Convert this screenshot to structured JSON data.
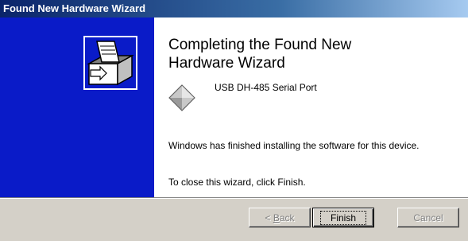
{
  "window": {
    "title": "Found New Hardware Wizard"
  },
  "content": {
    "heading_line1": "Completing the Found New",
    "heading_line2": "Hardware Wizard",
    "device_icon": "hardware-diamond-icon",
    "device_name": "USB DH-485 Serial Port",
    "message1": "Windows has finished installing the software for this device.",
    "message2": "To close this wizard, click Finish."
  },
  "buttons": {
    "back_prefix": "< ",
    "back_accel": "B",
    "back_rest": "ack",
    "finish": "Finish",
    "cancel": "Cancel"
  },
  "colors": {
    "sidebar": "#0a1bc8",
    "titlebar": "#0a246a",
    "face": "#d4d0c8"
  }
}
